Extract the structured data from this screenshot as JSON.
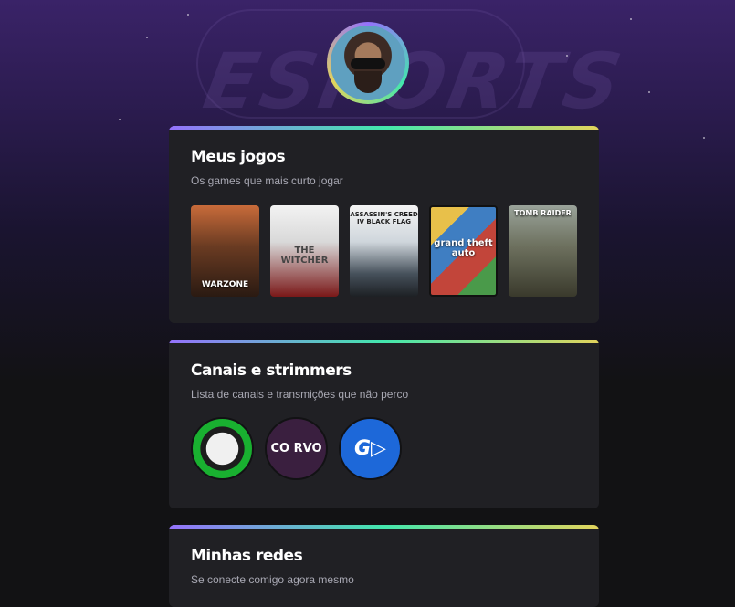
{
  "sections": [
    {
      "title": "Meus jogos",
      "subtitle": "Os games que mais curto jogar",
      "games": [
        {
          "name": "WARZONE"
        },
        {
          "name": "THE WITCHER"
        },
        {
          "name": "ASSASSIN'S CREED IV BLACK FLAG"
        },
        {
          "name": "grand theft auto"
        },
        {
          "name": "TOMB RAIDER"
        }
      ]
    },
    {
      "title": "Canais e strimmers",
      "subtitle": "Lista de canais e transmições que não perco",
      "channels": [
        {
          "logo": ""
        },
        {
          "logo": "CO RVO"
        },
        {
          "logo": "G▷"
        }
      ]
    },
    {
      "title": "Minhas redes",
      "subtitle": "Se conecte comigo agora mesmo"
    }
  ],
  "colors": {
    "gradient": [
      "#9572fc",
      "#43e7ad",
      "#e2d45c"
    ],
    "card": "#202024",
    "background": "#121214"
  }
}
